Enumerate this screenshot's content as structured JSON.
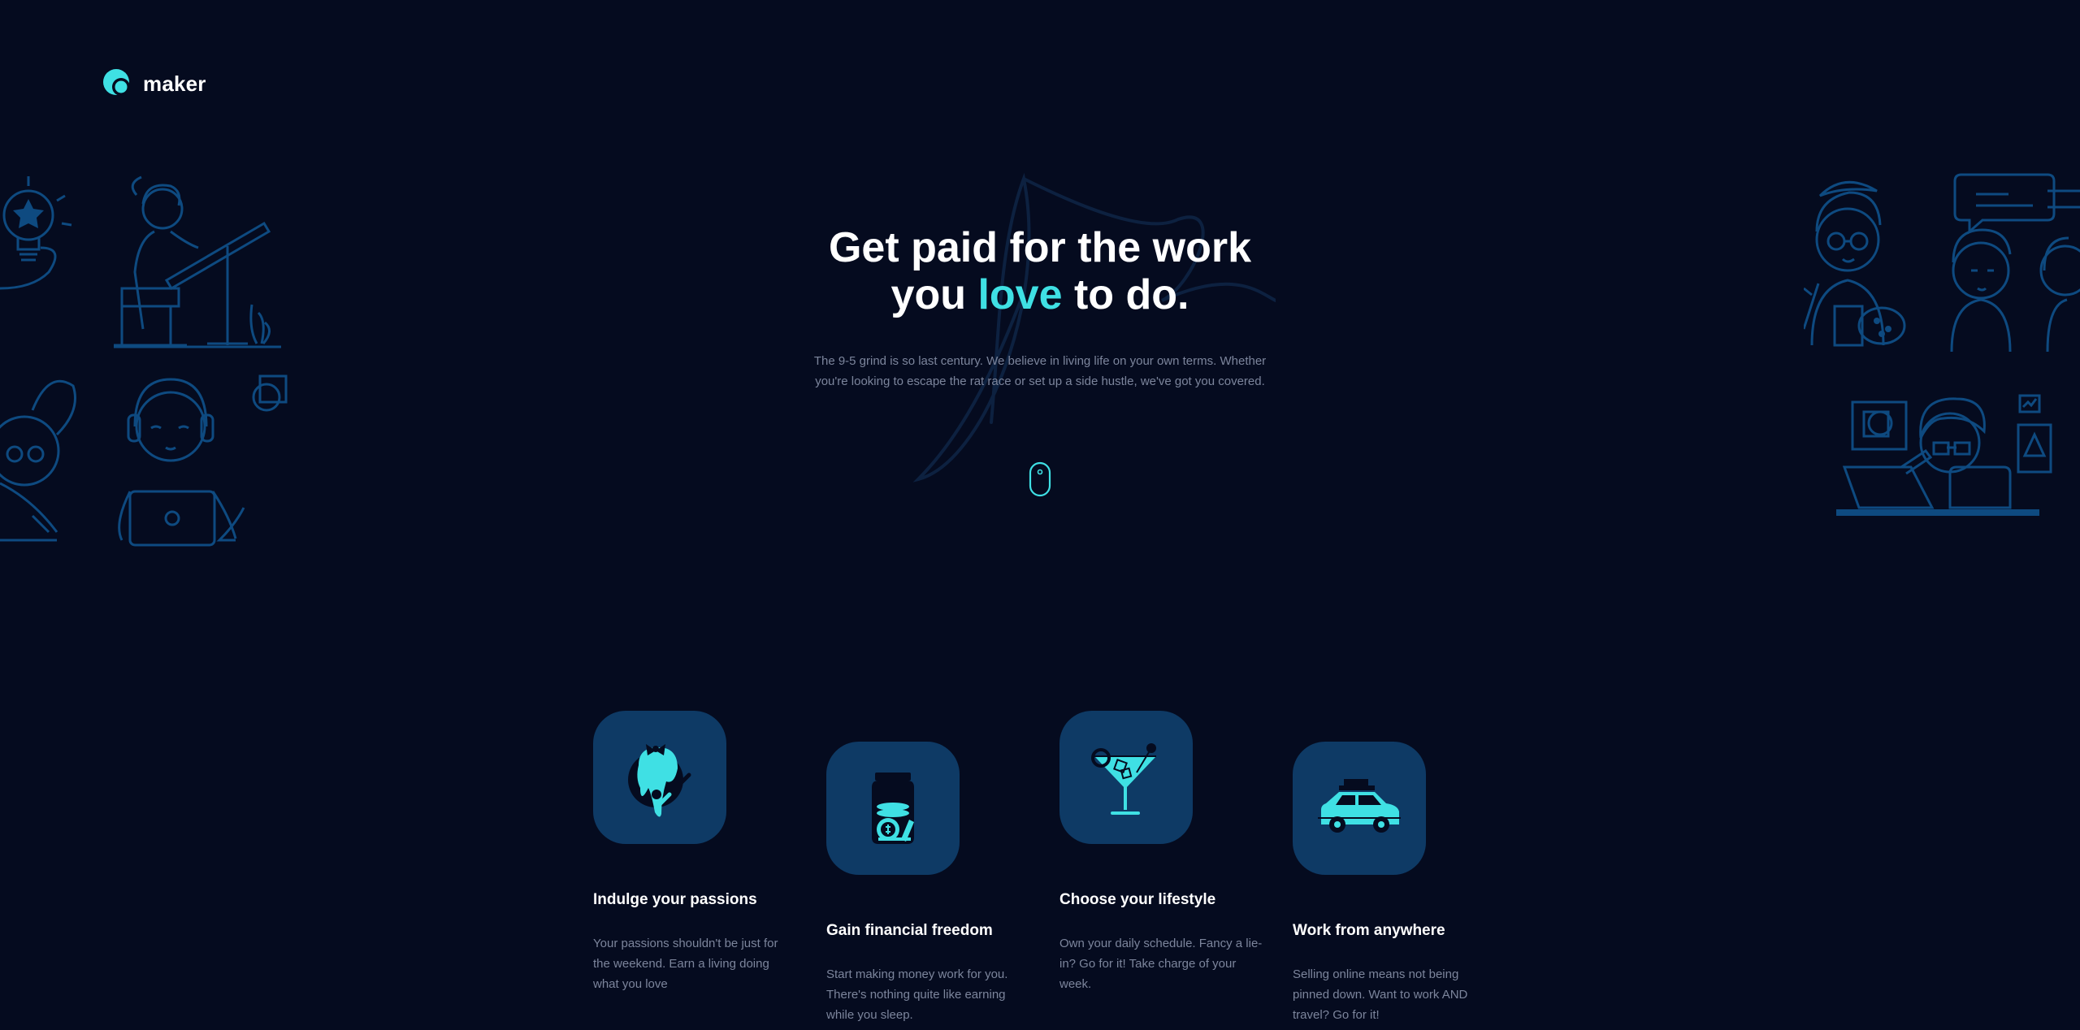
{
  "brand": {
    "name": "maker",
    "accent_color": "#3fe0e4",
    "background": "#050b1f"
  },
  "hero": {
    "title_line1": "Get paid for the work",
    "title_line2_pre": "you ",
    "title_line2_accent": "love",
    "title_line2_post": " to do.",
    "subtitle": "The 9-5 grind is so last century. We believe in living life on your own terms. Whether you're looking to escape the rat race or set up a side hustle, we've got you covered."
  },
  "scroll_indicator": {
    "icon": "mouse-icon"
  },
  "features": [
    {
      "icon": "paint-palette-icon",
      "title": "Indulge your passions",
      "text": "Your passions shouldn't be just for the weekend. Earn a living doing what you love"
    },
    {
      "icon": "money-jar-icon",
      "title": "Gain financial freedom",
      "text": "Start making money work for you. There's nothing quite like earning while you sleep."
    },
    {
      "icon": "cocktail-icon",
      "title": "Choose your lifestyle",
      "text": "Own your daily schedule. Fancy a lie-in? Go for it! Take charge of your week."
    },
    {
      "icon": "car-icon",
      "title": "Work from anywhere",
      "text": "Selling online means not being pinned down. Want to work AND travel? Go for it!"
    }
  ]
}
